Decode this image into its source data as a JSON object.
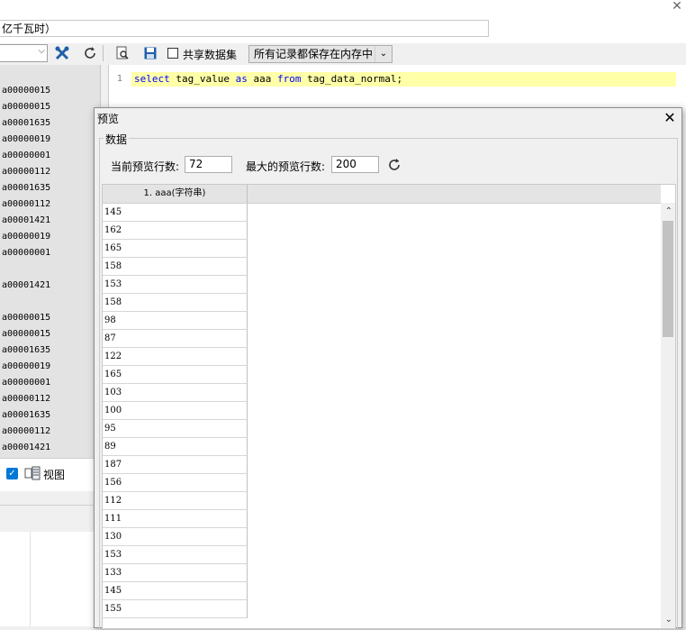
{
  "window": {
    "title_field_text": "亿千瓦时）",
    "close_glyph": "✕"
  },
  "toolbar": {
    "share_dataset_label": "共享数据集",
    "memory_mode_value": "所有记录都保存在内存中"
  },
  "left_panel": {
    "items": [
      "a00000015",
      "a00000015",
      "a00001635",
      "a00000019",
      "a00000001",
      "a00000112",
      "a00001635",
      "a00000112",
      "a00001421",
      "a00000019",
      "a00000001",
      "",
      "a00001421",
      "",
      "a00000015",
      "a00000015",
      "a00001635",
      "a00000019",
      "a00000001",
      "a00000112",
      "a00001635",
      "a00000112",
      "a00001421"
    ],
    "view_label": "视图",
    "view_checked": true
  },
  "editor": {
    "line_number": "1",
    "sql": {
      "kw_select": "select",
      "t1": " tag_value ",
      "kw_as": "as",
      "t2": " aaa ",
      "kw_from": "from",
      "t3": " tag_data_normal;"
    }
  },
  "dialog": {
    "title": "预览",
    "group_label": "数据",
    "current_rows_label": "当前预览行数:",
    "current_rows_value": "72",
    "max_rows_label": "最大的预览行数:",
    "max_rows_value": "200",
    "column_header": "1.  aaa(字符串)",
    "rows": [
      "145",
      "162",
      "165",
      "158",
      "153",
      "158",
      "98",
      "87",
      "122",
      "165",
      "103",
      "100",
      "95",
      "89",
      "187",
      "156",
      "112",
      "111",
      "130",
      "153",
      "133",
      "145",
      "155"
    ]
  },
  "colors": {
    "highlight_line": "#ffffa8",
    "keyword": "#0000ff",
    "checkbox_checked": "#0078d7"
  }
}
